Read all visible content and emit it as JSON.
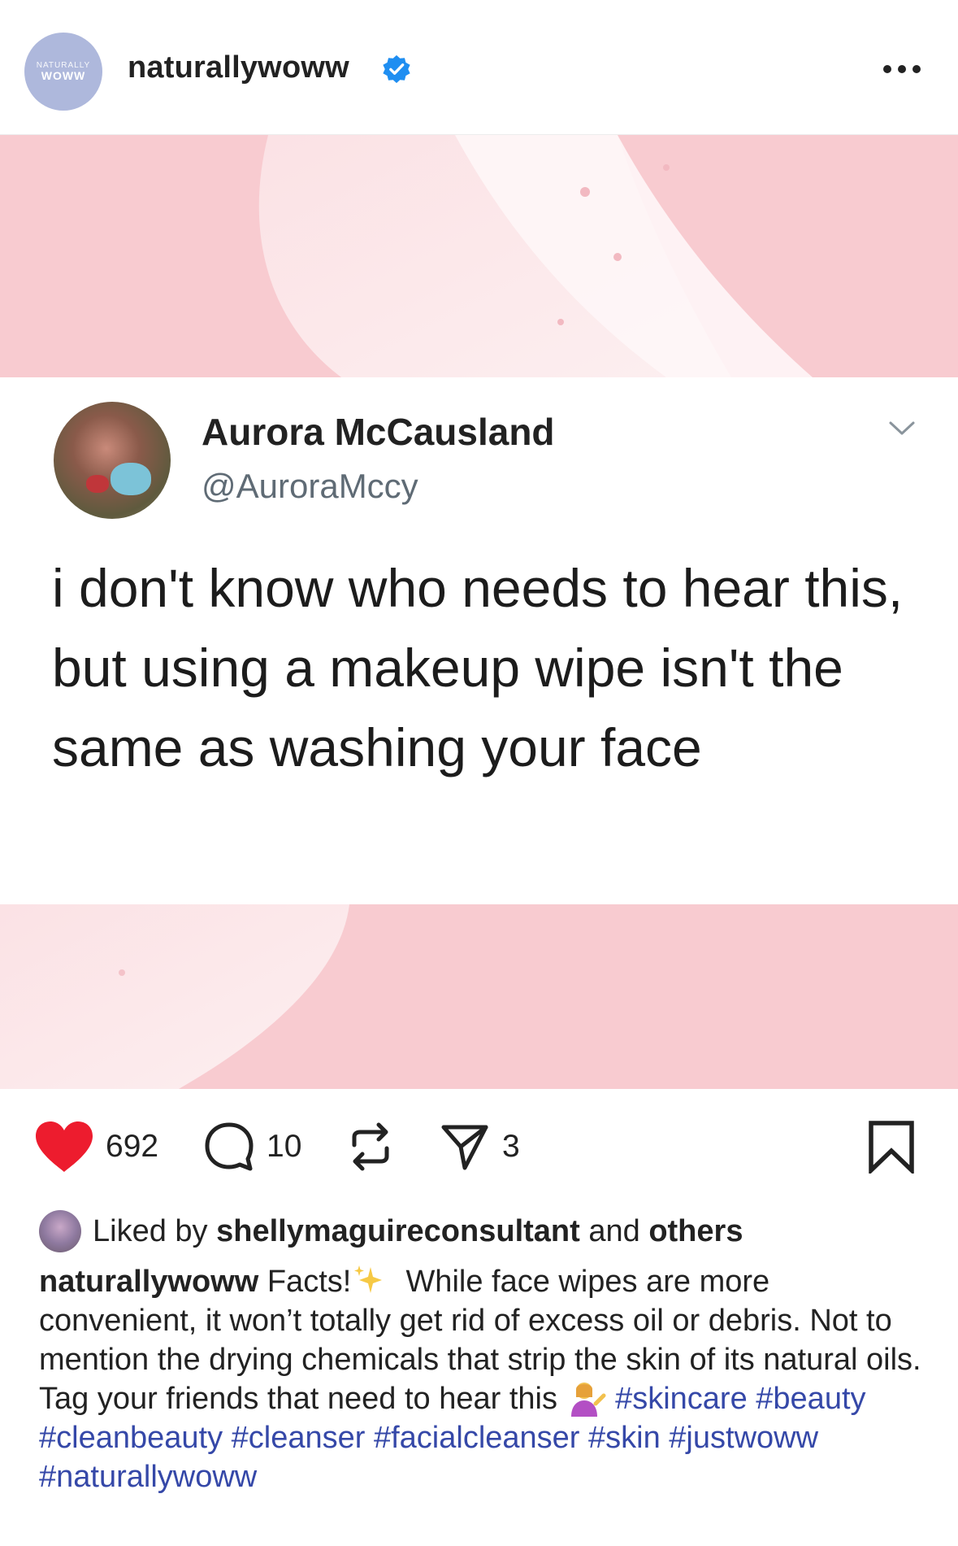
{
  "header": {
    "avatar_line1": "NATURALLY",
    "avatar_line2": "WOWW",
    "username": "naturallywoww",
    "verified_icon": "verified-badge-icon",
    "more_icon": "more-options-icon"
  },
  "tweet": {
    "name": "Aurora McCausland",
    "handle": "@AuroraMccy",
    "text": "i don't know who needs to hear this, but using a makeup wipe isn't the same as washing your face"
  },
  "actions": {
    "likes": "692",
    "comments": "10",
    "shares": "3",
    "like_color": "#ed1c2e"
  },
  "liked_by": {
    "prefix": "Liked by",
    "user": "shellymaguireconsultant",
    "and": "and",
    "others": "others"
  },
  "caption": {
    "author": "naturallywoww",
    "text1": "Facts!",
    "text2": "While face wipes are more convenient, it won’t totally get rid of excess oil or debris. Not to mention the drying chemicals that strip the skin of its natural oils. Tag your friends that need to hear this",
    "hashtags": [
      "#skincare",
      "#beauty",
      "#cleanbeauty",
      "#cleanser",
      "#facialcleanser",
      "#skin",
      "#justwoww",
      "#naturallywoww"
    ],
    "hashtag_color": "#3548a8"
  }
}
